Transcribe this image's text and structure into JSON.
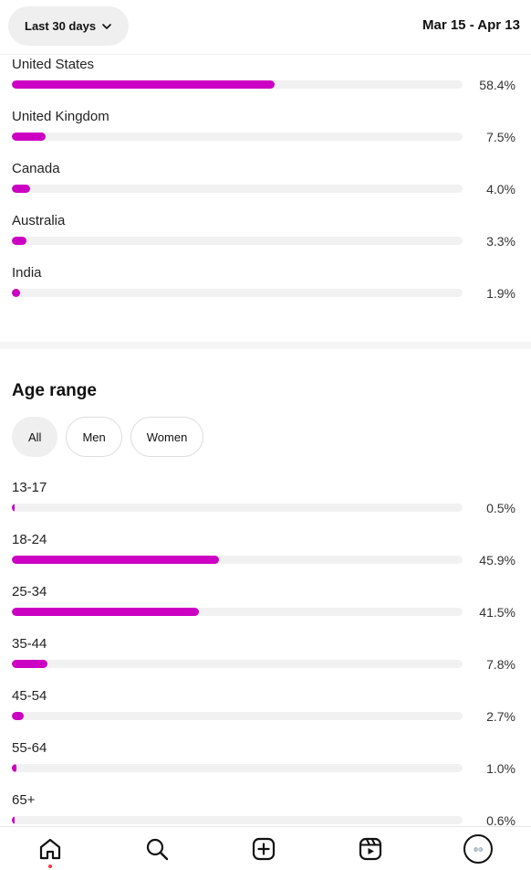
{
  "header": {
    "range_label": "Last 30 days",
    "date_range": "Mar 15 - Apr 13"
  },
  "countries": [
    {
      "label": "United States",
      "value": 58.4,
      "pct": "58.4%"
    },
    {
      "label": "United Kingdom",
      "value": 7.5,
      "pct": "7.5%"
    },
    {
      "label": "Canada",
      "value": 4.0,
      "pct": "4.0%"
    },
    {
      "label": "Australia",
      "value": 3.3,
      "pct": "3.3%"
    },
    {
      "label": "India",
      "value": 1.9,
      "pct": "1.9%"
    }
  ],
  "age": {
    "title": "Age range",
    "filters": [
      "All",
      "Men",
      "Women"
    ],
    "active_filter": "All",
    "rows": [
      {
        "label": "13-17",
        "value": 0.5,
        "pct": "0.5%"
      },
      {
        "label": "18-24",
        "value": 45.9,
        "pct": "45.9%"
      },
      {
        "label": "25-34",
        "value": 41.5,
        "pct": "41.5%"
      },
      {
        "label": "35-44",
        "value": 7.8,
        "pct": "7.8%"
      },
      {
        "label": "45-54",
        "value": 2.7,
        "pct": "2.7%"
      },
      {
        "label": "55-64",
        "value": 1.0,
        "pct": "1.0%"
      },
      {
        "label": "65+",
        "value": 0.6,
        "pct": "0.6%"
      }
    ]
  },
  "colors": {
    "bar_fill": "#cc00c2",
    "bar_track": "#f1f1f1",
    "notification_dot": "#ff3040"
  },
  "nav": {
    "icons": [
      "home-icon",
      "search-icon",
      "create-icon",
      "reels-icon",
      "profile-avatar"
    ]
  }
}
